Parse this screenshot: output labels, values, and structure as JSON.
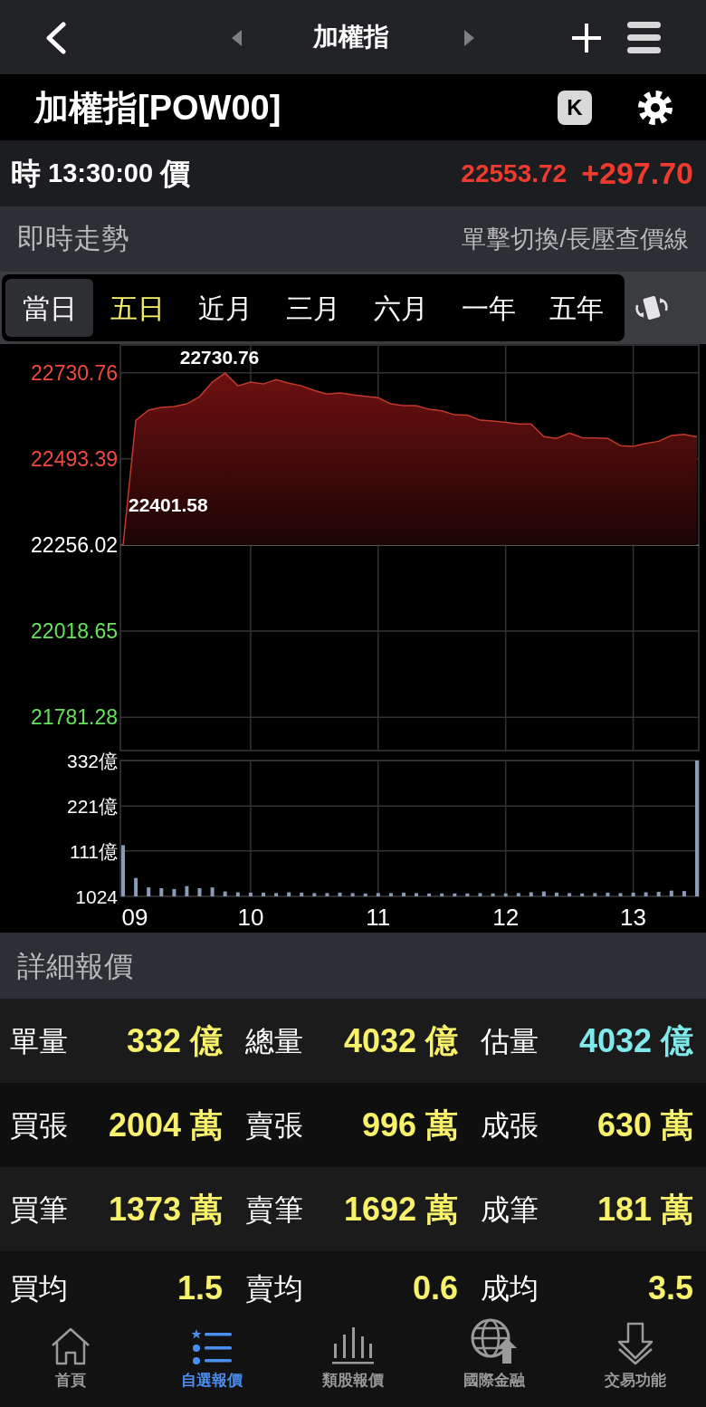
{
  "top_bar": {
    "title": "加權指"
  },
  "quote_header": {
    "name": "加權指[POW00]",
    "k_button": "K"
  },
  "price_row": {
    "time_label": "時",
    "time": "13:30:00",
    "price_label": "價",
    "price": "22553.72",
    "change": "+297.70"
  },
  "trend_section": {
    "title": "即時走勢",
    "hint": "單擊切換/長壓查價線"
  },
  "period_tabs": [
    {
      "label": "當日",
      "selected": true,
      "highlighted": false
    },
    {
      "label": "五日",
      "selected": false,
      "highlighted": true
    },
    {
      "label": "近月",
      "selected": false,
      "highlighted": false
    },
    {
      "label": "三月",
      "selected": false,
      "highlighted": false
    },
    {
      "label": "六月",
      "selected": false,
      "highlighted": false
    },
    {
      "label": "一年",
      "selected": false,
      "highlighted": false
    },
    {
      "label": "五年",
      "selected": false,
      "highlighted": false
    }
  ],
  "price_chart": {
    "chart_data": {
      "type": "area",
      "grid": true,
      "ref_lines": [
        {
          "axis": "y",
          "value": 22256.02
        }
      ],
      "xlim": [
        9,
        13.5
      ],
      "ylim": [
        21692,
        22805
      ],
      "x": [
        9.0,
        9.1,
        9.2,
        9.3,
        9.4,
        9.5,
        9.6,
        9.7,
        9.8,
        9.9,
        10.0,
        10.1,
        10.2,
        10.3,
        10.4,
        10.5,
        10.6,
        10.7,
        10.8,
        10.9,
        11.0,
        11.1,
        11.2,
        11.3,
        11.4,
        11.5,
        11.6,
        11.7,
        11.8,
        11.9,
        12.0,
        12.1,
        12.2,
        12.3,
        12.4,
        12.5,
        12.6,
        12.7,
        12.8,
        12.9,
        13.0,
        13.1,
        13.2,
        13.3,
        13.4,
        13.5
      ],
      "series": [
        {
          "color": "#c0392b",
          "values": [
            22256,
            22600,
            22628,
            22635,
            22638,
            22645,
            22665,
            22705,
            22730,
            22695,
            22705,
            22700,
            22712,
            22702,
            22695,
            22682,
            22672,
            22675,
            22670,
            22666,
            22662,
            22645,
            22640,
            22640,
            22630,
            22626,
            22615,
            22614,
            22600,
            22598,
            22594,
            22590,
            22590,
            22555,
            22550,
            22565,
            22552,
            22551,
            22550,
            22530,
            22528,
            22536,
            22542,
            22558,
            22561,
            22554
          ]
        }
      ],
      "yticks": [
        22730.76,
        22493.39,
        22256.02,
        22018.65,
        21781.28
      ],
      "annotations": [
        "22730.76",
        "22401.58"
      ]
    }
  },
  "volume_chart": {
    "bottom_label": "1024",
    "chart_data": {
      "type": "bar",
      "grid": true,
      "xlim": [
        9,
        13.5
      ],
      "ylim": [
        0,
        332
      ],
      "x": [
        9.0,
        9.1,
        9.2,
        9.3,
        9.4,
        9.5,
        9.6,
        9.7,
        9.8,
        9.9,
        10.0,
        10.1,
        10.2,
        10.3,
        10.4,
        10.5,
        10.6,
        10.7,
        10.8,
        10.9,
        11.0,
        11.1,
        11.2,
        11.3,
        11.4,
        11.5,
        11.6,
        11.7,
        11.8,
        11.9,
        12.0,
        12.1,
        12.2,
        12.3,
        12.4,
        12.5,
        12.6,
        12.7,
        12.8,
        12.9,
        13.0,
        13.1,
        13.2,
        13.3,
        13.4,
        13.5
      ],
      "series": [
        {
          "color": "#8a9bb5",
          "values": [
            125,
            45,
            22,
            20,
            18,
            25,
            20,
            22,
            12,
            10,
            9,
            9,
            8,
            10,
            9,
            8,
            8,
            9,
            8,
            7,
            8,
            8,
            9,
            8,
            7,
            7,
            7,
            7,
            8,
            7,
            7,
            8,
            10,
            12,
            9,
            8,
            7,
            8,
            9,
            8,
            9,
            10,
            11,
            14,
            13,
            332
          ]
        }
      ],
      "yticks": [
        {
          "value": 332,
          "label": "332億"
        },
        {
          "value": 221,
          "label": "221億"
        },
        {
          "value": 111,
          "label": "111億"
        }
      ],
      "xticks": [
        {
          "value": 9,
          "label": "09"
        },
        10,
        11,
        12,
        13
      ]
    }
  },
  "detail_section": {
    "title": "詳細報價",
    "rows": [
      [
        {
          "label": "單量",
          "value": "332 億",
          "color": "#f7f16b"
        },
        {
          "label": "總量",
          "value": "4032 億",
          "color": "#f7f16b"
        },
        {
          "label": "估量",
          "value": "4032 億",
          "color": "#7fe9ec"
        }
      ],
      [
        {
          "label": "買張",
          "value": "2004 萬",
          "color": "#f7f16b"
        },
        {
          "label": "賣張",
          "value": "996 萬",
          "color": "#f7f16b"
        },
        {
          "label": "成張",
          "value": "630 萬",
          "color": "#f7f16b"
        }
      ],
      [
        {
          "label": "買筆",
          "value": "1373 萬",
          "color": "#f7f16b"
        },
        {
          "label": "賣筆",
          "value": "1692 萬",
          "color": "#f7f16b"
        },
        {
          "label": "成筆",
          "value": "181 萬",
          "color": "#f7f16b"
        }
      ],
      [
        {
          "label": "買均",
          "value": "1.5",
          "color": "#f7f16b"
        },
        {
          "label": "賣均",
          "value": "0.6",
          "color": "#f7f16b"
        },
        {
          "label": "成均",
          "value": "3.5",
          "color": "#f7f16b"
        }
      ]
    ]
  },
  "bottom_nav": [
    {
      "label": "首頁",
      "selected": false
    },
    {
      "label": "自選報價",
      "selected": true
    },
    {
      "label": "類股報價",
      "selected": false
    },
    {
      "label": "國際金融",
      "selected": false
    },
    {
      "label": "交易功能",
      "selected": false
    }
  ]
}
